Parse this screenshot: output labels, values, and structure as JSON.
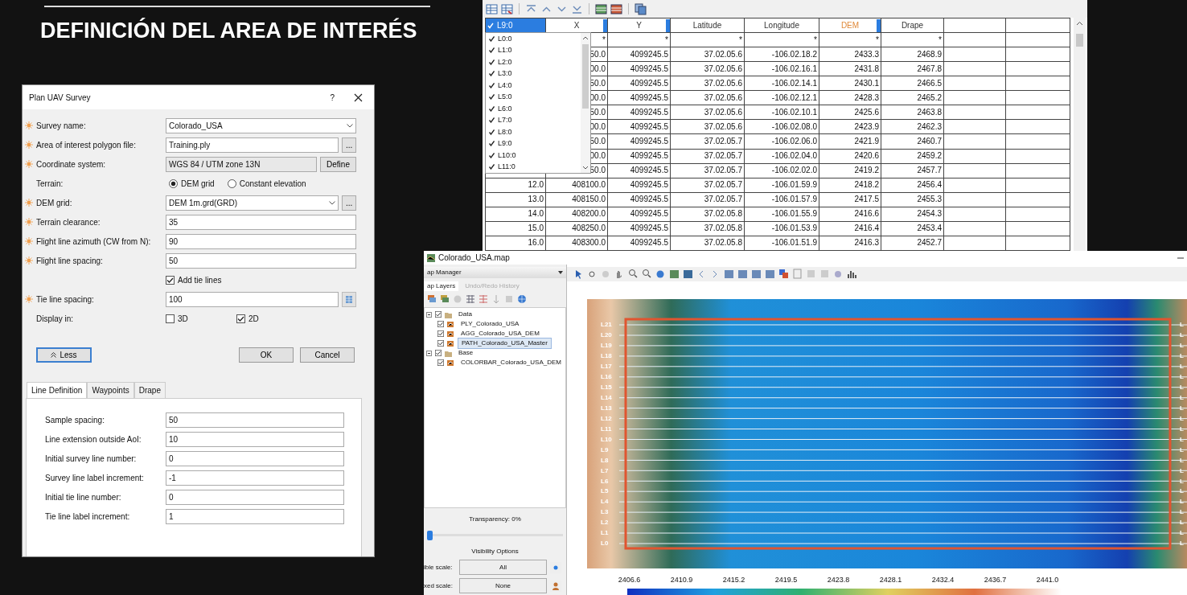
{
  "slide": {
    "title": "DEFINICIÓN DEL AREA DE INTERÉS"
  },
  "dialog": {
    "title": "Plan UAV Survey",
    "help": "?",
    "fields": [
      {
        "kind": "select",
        "label": "Survey name:",
        "required": true,
        "value": "Colorado_USA"
      },
      {
        "kind": "text",
        "label": "Area of interest polygon file:",
        "required": true,
        "value": "Training.ply",
        "button": {
          "kind": "browse",
          "label": "..."
        }
      },
      {
        "kind": "readonly",
        "label": "Coordinate system:",
        "required": true,
        "value": "WGS 84 / UTM zone 13N",
        "button": {
          "kind": "text",
          "label": "Define"
        }
      },
      {
        "kind": "radios",
        "label": "Terrain:",
        "required": false,
        "options": [
          {
            "label": "DEM grid",
            "selected": true
          },
          {
            "label": "Constant elevation",
            "selected": false
          }
        ]
      },
      {
        "kind": "select",
        "label": "DEM grid:",
        "required": true,
        "value": "DEM 1m.grd(GRD)",
        "button": {
          "kind": "browse",
          "label": "..."
        }
      },
      {
        "kind": "text",
        "label": "Terrain clearance:",
        "required": true,
        "value": "35"
      },
      {
        "kind": "text",
        "label": "Flight line azimuth (CW from N):",
        "required": true,
        "value": "90"
      },
      {
        "kind": "text",
        "label": "Flight line spacing:",
        "required": true,
        "value": "50"
      },
      {
        "kind": "checks",
        "required": false,
        "options": [
          {
            "label": "Add tie lines",
            "checked": true
          }
        ]
      },
      {
        "kind": "text",
        "label": "Tie line spacing:",
        "required": true,
        "value": "100",
        "button": {
          "kind": "icon"
        }
      },
      {
        "kind": "checks",
        "label": "Display in:",
        "required": false,
        "options": [
          {
            "label": "3D",
            "checked": false
          },
          {
            "label": "2D",
            "checked": true
          }
        ]
      }
    ],
    "less_button": "Less",
    "buttons": [
      "OK",
      "Cancel"
    ],
    "tabs": [
      {
        "label": "Line Definition",
        "selected": true
      },
      {
        "label": "Waypoints",
        "selected": false
      },
      {
        "label": "Drape",
        "selected": false
      }
    ],
    "tab_fields": [
      {
        "label": "Sample spacing:",
        "value": "50"
      },
      {
        "label": "Line extension outside AoI:",
        "value": "10"
      },
      {
        "label": "Initial survey line number:",
        "value": "0"
      },
      {
        "label": "Survey line label increment:",
        "value": "-1"
      },
      {
        "label": "Initial tie line number:",
        "value": "0"
      },
      {
        "label": "Tie line label increment:",
        "value": "1"
      }
    ]
  },
  "table": {
    "filter": {
      "value": "L9:0",
      "checked": true,
      "options": [
        {
          "label": "L0:0",
          "checked": true
        },
        {
          "label": "L1:0",
          "checked": true
        },
        {
          "label": "L2:0",
          "checked": true
        },
        {
          "label": "L3:0",
          "checked": true
        },
        {
          "label": "L4:0",
          "checked": true
        },
        {
          "label": "L5:0",
          "checked": true
        },
        {
          "label": "L6:0",
          "checked": true
        },
        {
          "label": "L7:0",
          "checked": true
        },
        {
          "label": "L8:0",
          "checked": true
        },
        {
          "label": "L9:0",
          "checked": true
        },
        {
          "label": "L10:0",
          "checked": true
        },
        {
          "label": "L11:0",
          "checked": true
        }
      ]
    },
    "columns": [
      {
        "label": "X",
        "marker": true,
        "highlighted": false
      },
      {
        "label": "Y",
        "marker": true,
        "highlighted": false
      },
      {
        "label": "Latitude",
        "marker": false,
        "highlighted": false
      },
      {
        "label": "Longitude",
        "marker": false,
        "highlighted": false
      },
      {
        "label": "DEM",
        "marker": true,
        "highlighted": true
      },
      {
        "label": "Drape",
        "marker": false,
        "highlighted": false
      }
    ],
    "new_row": [
      "*",
      "*",
      "*",
      "*",
      "*",
      "*"
    ],
    "rows": [
      {
        "cells": [
          "50.0",
          "4099245.5",
          "37.02.05.6",
          "-106.02.18.2",
          "2433.3",
          "2468.9"
        ]
      },
      {
        "cells": [
          "00.0",
          "4099245.5",
          "37.02.05.6",
          "-106.02.16.1",
          "2431.8",
          "2467.8"
        ]
      },
      {
        "cells": [
          "50.0",
          "4099245.5",
          "37.02.05.6",
          "-106.02.14.1",
          "2430.1",
          "2466.5"
        ]
      },
      {
        "cells": [
          "00.0",
          "4099245.5",
          "37.02.05.6",
          "-106.02.12.1",
          "2428.3",
          "2465.2"
        ]
      },
      {
        "cells": [
          "50.0",
          "4099245.5",
          "37.02.05.6",
          "-106.02.10.1",
          "2425.6",
          "2463.8"
        ]
      },
      {
        "cells": [
          "00.0",
          "4099245.5",
          "37.02.05.6",
          "-106.02.08.0",
          "2423.9",
          "2462.3"
        ]
      },
      {
        "cells": [
          "50.0",
          "4099245.5",
          "37.02.05.7",
          "-106.02.06.0",
          "2421.9",
          "2460.7"
        ]
      },
      {
        "cells": [
          "00.0",
          "4099245.5",
          "37.02.05.7",
          "-106.02.04.0",
          "2420.6",
          "2459.2"
        ]
      },
      {
        "cells": [
          "50.0",
          "4099245.5",
          "37.02.05.7",
          "-106.02.02.0",
          "2419.2",
          "2457.7"
        ]
      },
      {
        "index": "12.0",
        "cells": [
          "408100.0",
          "4099245.5",
          "37.02.05.7",
          "-106.01.59.9",
          "2418.2",
          "2456.4"
        ]
      },
      {
        "index": "13.0",
        "cells": [
          "408150.0",
          "4099245.5",
          "37.02.05.7",
          "-106.01.57.9",
          "2417.5",
          "2455.3"
        ]
      },
      {
        "index": "14.0",
        "cells": [
          "408200.0",
          "4099245.5",
          "37.02.05.8",
          "-106.01.55.9",
          "2416.6",
          "2454.3"
        ]
      },
      {
        "index": "15.0",
        "cells": [
          "408250.0",
          "4099245.5",
          "37.02.05.8",
          "-106.01.53.9",
          "2416.4",
          "2453.4"
        ]
      },
      {
        "index": "16.0",
        "cells": [
          "408300.0",
          "4099245.5",
          "37.02.05.8",
          "-106.01.51.9",
          "2416.3",
          "2452.7"
        ]
      }
    ]
  },
  "map": {
    "title": "Colorado_USA.map",
    "manager": {
      "title": "ap Manager",
      "tabs": [
        {
          "label": "ap Layers",
          "selected": true
        },
        {
          "label": "Undo/Redo History",
          "selected": false
        }
      ],
      "layers": [
        {
          "label": "Data",
          "checked": true,
          "selected": false,
          "children": [
            {
              "label": "PLY_Colorado_USA",
              "checked": true,
              "selected": false
            },
            {
              "label": "AGG_Colorado_USA_DEM",
              "checked": true,
              "selected": false
            },
            {
              "label": "PATH_Colorado_USA_Master",
              "checked": true,
              "selected": true
            }
          ]
        },
        {
          "label": "Base",
          "checked": true,
          "selected": false,
          "children": [
            {
              "label": "COLORBAR_Colorado_USA_DEM",
              "checked": true,
              "selected": false
            }
          ]
        }
      ],
      "transparency": {
        "label": "Transparency: 0%",
        "level": 0
      },
      "visibility_title": "Visibility Options",
      "scales": [
        {
          "label": "ible scale:",
          "value": "All"
        },
        {
          "label": "xed scale:",
          "value": "None"
        }
      ]
    },
    "line_labels": [
      {
        "left": "L21",
        "right": "L"
      },
      {
        "left": "L20",
        "right": "L"
      },
      {
        "left": "L19",
        "right": "L"
      },
      {
        "left": "L18",
        "right": "L"
      },
      {
        "left": "L17",
        "right": "L"
      },
      {
        "left": "L16",
        "right": "L"
      },
      {
        "left": "L15",
        "right": "L"
      },
      {
        "left": "L14",
        "right": "L"
      },
      {
        "left": "L13",
        "right": "L"
      },
      {
        "left": "L12",
        "right": "L"
      },
      {
        "left": "L11",
        "right": "L"
      },
      {
        "left": "L10",
        "right": "L"
      },
      {
        "left": "L9",
        "right": "L"
      },
      {
        "left": "L8",
        "right": "L"
      },
      {
        "left": "L7",
        "right": "L"
      },
      {
        "left": "L6",
        "right": "L"
      },
      {
        "left": "L5",
        "right": "L"
      },
      {
        "left": "L4",
        "right": "L"
      },
      {
        "left": "L3",
        "right": "L"
      },
      {
        "left": "L2",
        "right": "L"
      },
      {
        "left": "L1",
        "right": "L"
      },
      {
        "left": "L0",
        "right": "L"
      }
    ],
    "colorbar_labels": [
      "2406.6",
      "2410.9",
      "2415.2",
      "2419.5",
      "2423.8",
      "2428.1",
      "2432.4",
      "2436.7",
      "2441.0"
    ]
  }
}
